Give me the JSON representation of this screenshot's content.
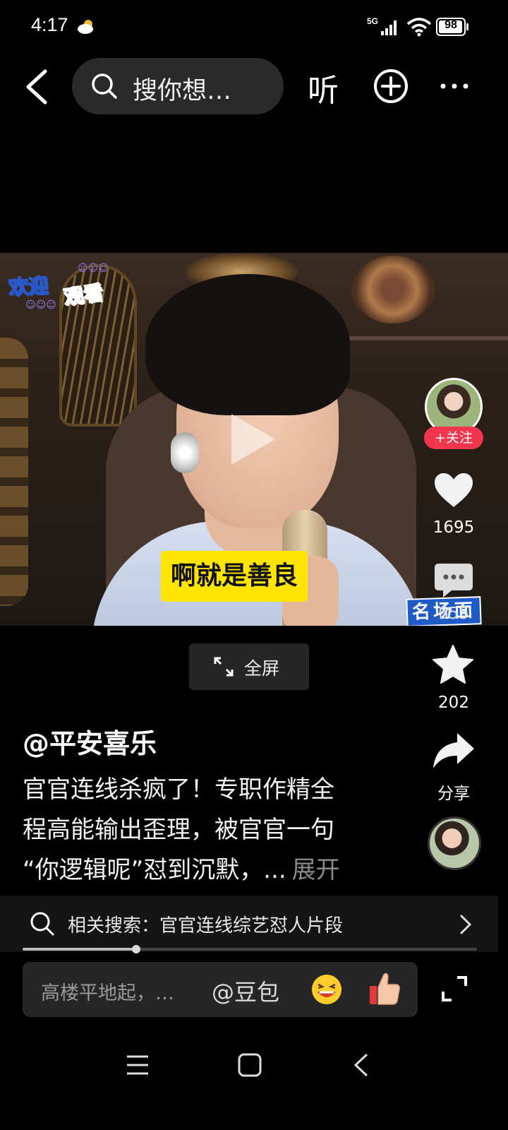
{
  "status_bar": {
    "time": "4:17",
    "network": "5G",
    "battery": "98",
    "battery_level": 0.98
  },
  "top_bar": {
    "search_placeholder": "搜你想…",
    "listen_label": "听",
    "icons": [
      "back-icon",
      "search-icon",
      "add-circle-icon",
      "more-icon"
    ]
  },
  "video": {
    "welcome_line1": "欢迎",
    "welcome_line2": "观看",
    "subtitle": "啊就是善良",
    "corner_badge": "名场面"
  },
  "side_actions": {
    "follow_label": "+关注",
    "like_count": "1695",
    "comment_count": "655",
    "favorite_count": "202",
    "share_label": "分享"
  },
  "fullscreen": {
    "label": "全屏"
  },
  "post": {
    "author": "@平安喜乐",
    "caption_lines": [
      "官官连线杀疯了！专职作精全",
      "程高能输出歪理，被官官一句",
      "“你逻辑呢”怼到沉默，..."
    ],
    "expand_label": "展开"
  },
  "related_search": {
    "text": "相关搜索：官官连线综艺怼人片段"
  },
  "playback": {
    "progress": 0.25
  },
  "comment_box": {
    "placeholder": "高楼平地起，…",
    "mention": "@豆包"
  },
  "colors": {
    "background": "#000000",
    "follow_red": "#f2364e",
    "subtitle_yellow": "#ffe500",
    "panel_gray": "#262626"
  }
}
